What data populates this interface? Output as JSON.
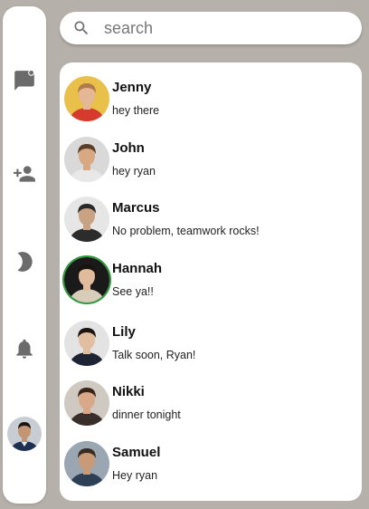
{
  "sidebar": {
    "icons": [
      {
        "name": "chat-icon"
      },
      {
        "name": "add-contact-icon"
      },
      {
        "name": "dark-mode-icon"
      },
      {
        "name": "notifications-icon"
      }
    ],
    "user_avatar": "profile-avatar"
  },
  "search": {
    "placeholder": "search",
    "value": ""
  },
  "contacts": [
    {
      "name": "Jenny",
      "message": "hey there",
      "avatar_bg": "#e8c04a",
      "shirt": "#d63a2c",
      "skin": "#e4b896",
      "hair": "#b07a4a"
    },
    {
      "name": "John",
      "message": "hey ryan",
      "avatar_bg": "#d9d9d9",
      "shirt": "#e8e8e8",
      "skin": "#d7a882",
      "hair": "#5a3e2a"
    },
    {
      "name": "Marcus",
      "message": "No problem, teamwork rocks!",
      "avatar_bg": "#e6e6e6",
      "shirt": "#2c2c2c",
      "skin": "#c9a183",
      "hair": "#2a2a2a"
    },
    {
      "name": "Hannah",
      "message": "See ya!!",
      "avatar_bg": "#1a1a1a",
      "shirt": "#d8cdb8",
      "skin": "#e0bc9c",
      "hair": "#1a120c",
      "active": true
    },
    {
      "name": "Lily",
      "message": "Talk soon, Ryan!",
      "avatar_bg": "#e3e3e3",
      "shirt": "#1d2433",
      "skin": "#e2bea0",
      "hair": "#1c1410"
    },
    {
      "name": "Nikki",
      "message": "dinner tonight",
      "avatar_bg": "#cfc9c2",
      "shirt": "#3a2e2a",
      "skin": "#d8a888",
      "hair": "#3a2418"
    },
    {
      "name": "Samuel",
      "message": "Hey ryan",
      "avatar_bg": "#9aa7b3",
      "shirt": "#2d3f57",
      "skin": "#c99a78",
      "hair": "#3a2a20"
    }
  ],
  "colors": {
    "background": "#b6b0aa",
    "panel": "#ffffff",
    "icon": "#6b6b6b",
    "active_ring": "#2e9a3c"
  }
}
